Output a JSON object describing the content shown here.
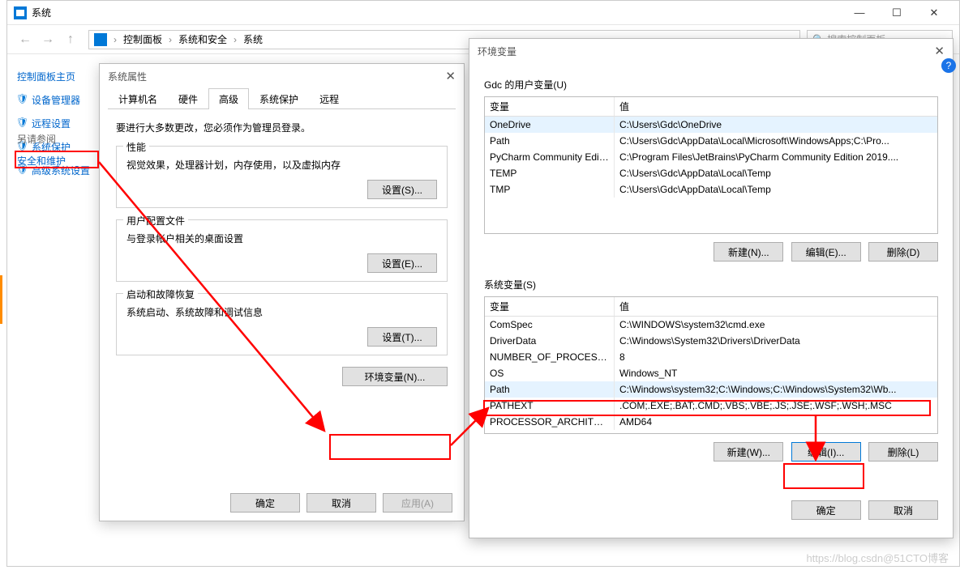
{
  "window": {
    "title": "系统",
    "breadcrumb": [
      "控制面板",
      "系统和安全",
      "系统"
    ],
    "search_placeholder": "搜索控制面板"
  },
  "sidebar": {
    "home": "控制面板主页",
    "items": [
      "设备管理器",
      "远程设置",
      "系统保护",
      "高级系统设置"
    ],
    "see_also": "另请参阅",
    "security": "安全和维护"
  },
  "props": {
    "title": "系统属性",
    "tabs": [
      "计算机名",
      "硬件",
      "高级",
      "系统保护",
      "远程"
    ],
    "active_tab": 2,
    "note": "要进行大多数更改，您必须作为管理员登录。",
    "perf": {
      "label": "性能",
      "desc": "视觉效果，处理器计划，内存使用，以及虚拟内存",
      "btn": "设置(S)..."
    },
    "profiles": {
      "label": "用户配置文件",
      "desc": "与登录帐户相关的桌面设置",
      "btn": "设置(E)..."
    },
    "startup": {
      "label": "启动和故障恢复",
      "desc": "系统启动、系统故障和调试信息",
      "btn": "设置(T)..."
    },
    "env_btn": "环境变量(N)...",
    "ok": "确定",
    "cancel": "取消",
    "apply": "应用(A)"
  },
  "env": {
    "title": "环境变量",
    "user_caption": "Gdc 的用户变量(U)",
    "sys_caption": "系统变量(S)",
    "col_var": "变量",
    "col_val": "值",
    "user_rows": [
      {
        "k": "OneDrive",
        "v": "C:\\Users\\Gdc\\OneDrive"
      },
      {
        "k": "Path",
        "v": "C:\\Users\\Gdc\\AppData\\Local\\Microsoft\\WindowsApps;C:\\Pro..."
      },
      {
        "k": "PyCharm Community Editi...",
        "v": "C:\\Program Files\\JetBrains\\PyCharm Community Edition 2019...."
      },
      {
        "k": "TEMP",
        "v": "C:\\Users\\Gdc\\AppData\\Local\\Temp"
      },
      {
        "k": "TMP",
        "v": "C:\\Users\\Gdc\\AppData\\Local\\Temp"
      }
    ],
    "sys_rows": [
      {
        "k": "ComSpec",
        "v": "C:\\WINDOWS\\system32\\cmd.exe"
      },
      {
        "k": "DriverData",
        "v": "C:\\Windows\\System32\\Drivers\\DriverData"
      },
      {
        "k": "NUMBER_OF_PROCESSORS",
        "v": "8"
      },
      {
        "k": "OS",
        "v": "Windows_NT"
      },
      {
        "k": "Path",
        "v": "C:\\Windows\\system32;C:\\Windows;C:\\Windows\\System32\\Wb..."
      },
      {
        "k": "PATHEXT",
        "v": ".COM;.EXE;.BAT;.CMD;.VBS;.VBE;.JS;.JSE;.WSF;.WSH;.MSC"
      },
      {
        "k": "PROCESSOR_ARCHITECT...",
        "v": "AMD64"
      }
    ],
    "new_u": "新建(N)...",
    "edit_u": "编辑(E)...",
    "del_u": "删除(D)",
    "new_s": "新建(W)...",
    "edit_s": "编辑(I)...",
    "del_s": "删除(L)",
    "ok": "确定",
    "cancel": "取消"
  },
  "watermark": "https://blog.csdn@51CTO博客"
}
